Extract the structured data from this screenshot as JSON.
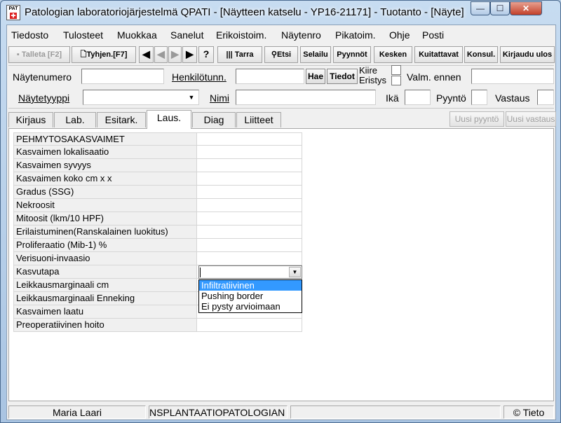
{
  "window": {
    "title": "Patologian laboratoriojärjestelmä QPATI - [Näytteen katselu - YP16-21171] - Tuotanto - [Näyte]",
    "icon_text": "PAT",
    "min_glyph": "—",
    "max_glyph": "☐",
    "close_glyph": "✕"
  },
  "menu": [
    "Tiedosto",
    "Tulosteet",
    "Muokkaa",
    "Sanelut",
    "Erikoistoim.",
    "Näytenro",
    "Pikatoim.",
    "Ohje",
    "Posti"
  ],
  "toolbar": {
    "save": "Talleta [F2]",
    "clear": "Tyhjen.[F7]",
    "first_glyph": "◀",
    "prev_glyph": "◀",
    "next_glyph": "▶",
    "last_glyph": "▶",
    "help_glyph": "?",
    "label": "Tarra",
    "search": "Etsi",
    "browse": "Selailu",
    "requests": "Pyynnöt",
    "unfinished": "Kesken",
    "acknowledged": "Kuitattavat",
    "consult": "Konsul.",
    "logout": "Kirjaudu ulos"
  },
  "form": {
    "sample_number_label": "Näytenumero",
    "sample_number_value": "",
    "person_id_label": "Henkilötunn.",
    "person_id_value": "",
    "fetch_button": "Hae",
    "info_button": "Tiedot",
    "urgent_label": "Kiire",
    "isolation_label": "Eristys",
    "ready_before_label": "Valm. ennen",
    "ready_before_value": "",
    "sample_type_label": "Näytetyyppi",
    "sample_type_value": "",
    "name_label": "Nimi",
    "name_value": "",
    "age_label": "Ikä",
    "age_value": "",
    "request_label": "Pyyntö",
    "request_value": "",
    "answer_label": "Vastaus",
    "answer_value": ""
  },
  "tabs": [
    "Kirjaus",
    "Lab.",
    "Esitark.",
    "Laus.",
    "Diag",
    "Liitteet"
  ],
  "active_tab": "Laus.",
  "tab_buttons": {
    "new_request": "Uusi pyyntö",
    "new_answer": "Uusi vastaus"
  },
  "grid_rows": [
    {
      "label": "PEHMYTOSAKASVAIMET",
      "value": ""
    },
    {
      "label": "Kasvaimen lokalisaatio",
      "value": ""
    },
    {
      "label": "Kasvaimen syvyys",
      "value": ""
    },
    {
      "label": "Kasvaimen koko cm x x",
      "value": ""
    },
    {
      "label": "Gradus (SSG)",
      "value": ""
    },
    {
      "label": "Nekroosit",
      "value": ""
    },
    {
      "label": "Mitoosit (lkm/10 HPF)",
      "value": ""
    },
    {
      "label": "Erilaistuminen(Ranskalainen luokitus)",
      "value": ""
    },
    {
      "label": "Proliferaatio (Mib-1) %",
      "value": ""
    },
    {
      "label": "Verisuoni-invaasio",
      "value": ""
    },
    {
      "label": "Kasvutapa",
      "value": ""
    },
    {
      "label": "Leikkausmarginaali cm",
      "value": ""
    },
    {
      "label": "Leikkausmarginaali Enneking",
      "value": ""
    },
    {
      "label": "Kasvaimen laatu",
      "value": ""
    },
    {
      "label": "Preoperatiivinen hoito",
      "value": ""
    }
  ],
  "dropdown": {
    "options": [
      "Infiltratiivinen",
      "Pushing border",
      "Ei pysty arvioimaan"
    ],
    "highlighted": "Infiltratiivinen"
  },
  "status": {
    "user": "Maria Laari",
    "unit": "NSPLANTAATIOPATOLOGIAN",
    "extra": "",
    "copyright": "© Tieto"
  }
}
